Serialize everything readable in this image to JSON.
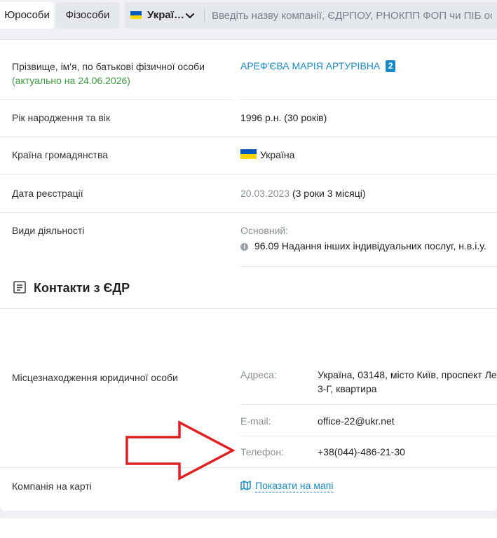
{
  "tabs": {
    "legal": "Юрособи",
    "physical": "Фізособи"
  },
  "search": {
    "country": "Украї…",
    "placeholder": "Введіть назву компанії, ЄДРПОУ, РНОКПП ФОП чи ПІБ особи"
  },
  "colors": {
    "accent": "#1a8ac6",
    "green": "#3a9b3f",
    "arrow": "#e02020",
    "flag_blue": "#005bbb",
    "flag_yellow": "#ffd500"
  },
  "person": {
    "label": "Прізвище, ім'я, по батькові фізичної особи",
    "actual_note": "(актуально на 24.06.2026)",
    "name": "АРЕФ'ЄВА МАРІЯ АРТУРІВНА",
    "badge": "2"
  },
  "birth": {
    "label": "Рік народження та вік",
    "value": "1996 р.н. (30 років)"
  },
  "citizenship": {
    "label": "Країна громадянства",
    "value": "Україна"
  },
  "registration": {
    "label": "Дата реєстрації",
    "date": "20.03.2023",
    "duration": "(3 роки 3 місяці)"
  },
  "activity": {
    "label": "Види діяльності",
    "main_label": "Основний:",
    "main_value": "96.09 Надання інших індивідуальних послуг, н.в.і.у."
  },
  "contacts": {
    "title": "Контакти з ЄДР",
    "location_label": "Місцезнаходження юридичної особи",
    "address_label": "Адреса:",
    "address_line1": "Україна, 03148, місто Київ, проспект Ле",
    "address_line2": "3-Г, квартира",
    "email_label": "E-mail:",
    "email": "office-22@ukr.net",
    "phone_label": "Телефон:",
    "phone": "+38(044)-486-21-30"
  },
  "map": {
    "label": "Компанія на карті",
    "link": "Показати на мапі"
  }
}
